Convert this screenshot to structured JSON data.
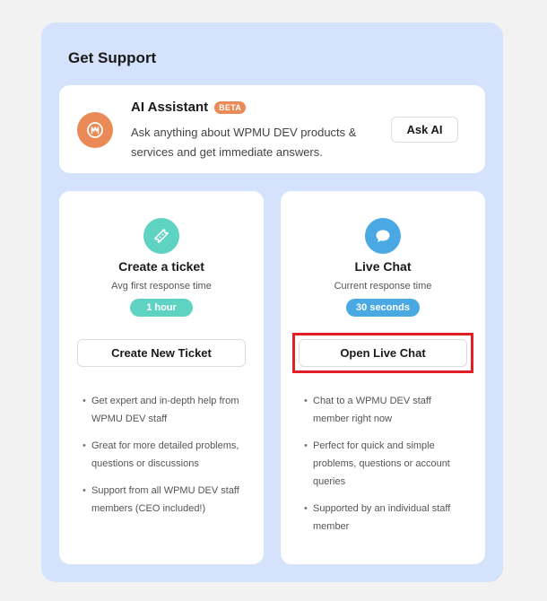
{
  "panel": {
    "title": "Get Support"
  },
  "ai": {
    "title": "AI Assistant",
    "badge": "BETA",
    "description": "Ask anything about WPMU DEV products & services and get immediate answers.",
    "button": "Ask AI",
    "icon": "ai-logo-icon",
    "color": "#ea8a57"
  },
  "ticket": {
    "icon": "ticket-icon",
    "color": "#5fd3c1",
    "title": "Create a ticket",
    "subtitle": "Avg first response time",
    "time": "1 hour",
    "button": "Create New Ticket",
    "bullets": [
      "Get expert and in-depth help from WPMU DEV staff",
      "Great for more detailed problems, questions or discussions",
      "Support from all WPMU DEV staff members (CEO included!)"
    ]
  },
  "chat": {
    "icon": "chat-bubble-icon",
    "color": "#4aa8e2",
    "title": "Live Chat",
    "subtitle": "Current response time",
    "time": "30 seconds",
    "button": "Open Live Chat",
    "bullets": [
      "Chat to a WPMU DEV staff member right now",
      "Perfect for quick and simple problems, questions or account queries",
      "Supported by an individual staff member"
    ]
  }
}
